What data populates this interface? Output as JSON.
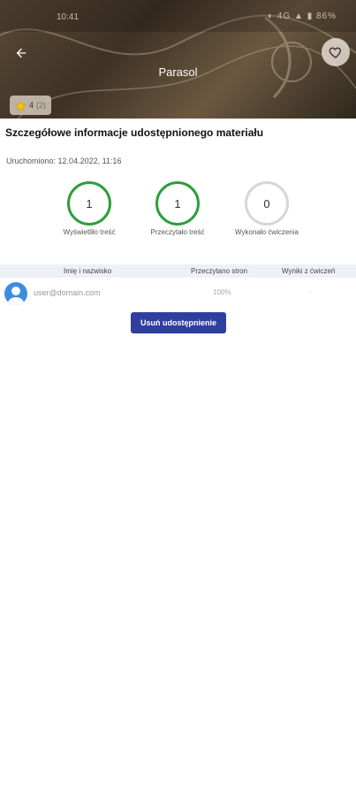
{
  "status_bar": {
    "time": "10:41",
    "icons_text": "◐ 4G ▲ ▮ 86%"
  },
  "header": {
    "title": "Parasol",
    "rating": {
      "value": "4",
      "count": "(2)"
    }
  },
  "details": {
    "title": "Szczegółowe informacje udostępnionego materiału",
    "launched_label": "Uruchomiono:",
    "launched_value": "12.04.2022, 11:16"
  },
  "stats": [
    {
      "value": "1",
      "label": "Wyświetliło treść",
      "color": "#2e9e3a"
    },
    {
      "value": "1",
      "label": "Przeczytało treść",
      "color": "#2e9e3a"
    },
    {
      "value": "0",
      "label": "Wykonało ćwiczenia",
      "color": "#d6d6d6"
    }
  ],
  "table": {
    "headers": [
      "Imię i nazwisko",
      "Przeczytano stron",
      "Wyniki z ćwiczeń"
    ],
    "rows": [
      {
        "email": "user@domain.com",
        "pages": "100%",
        "results": "-"
      }
    ]
  },
  "actions": {
    "remove_share_label": "Usuń udostępnienie"
  },
  "colors": {
    "accent": "#2f3f9e",
    "success": "#2e9e3a",
    "avatar": "#3d8ce0"
  }
}
